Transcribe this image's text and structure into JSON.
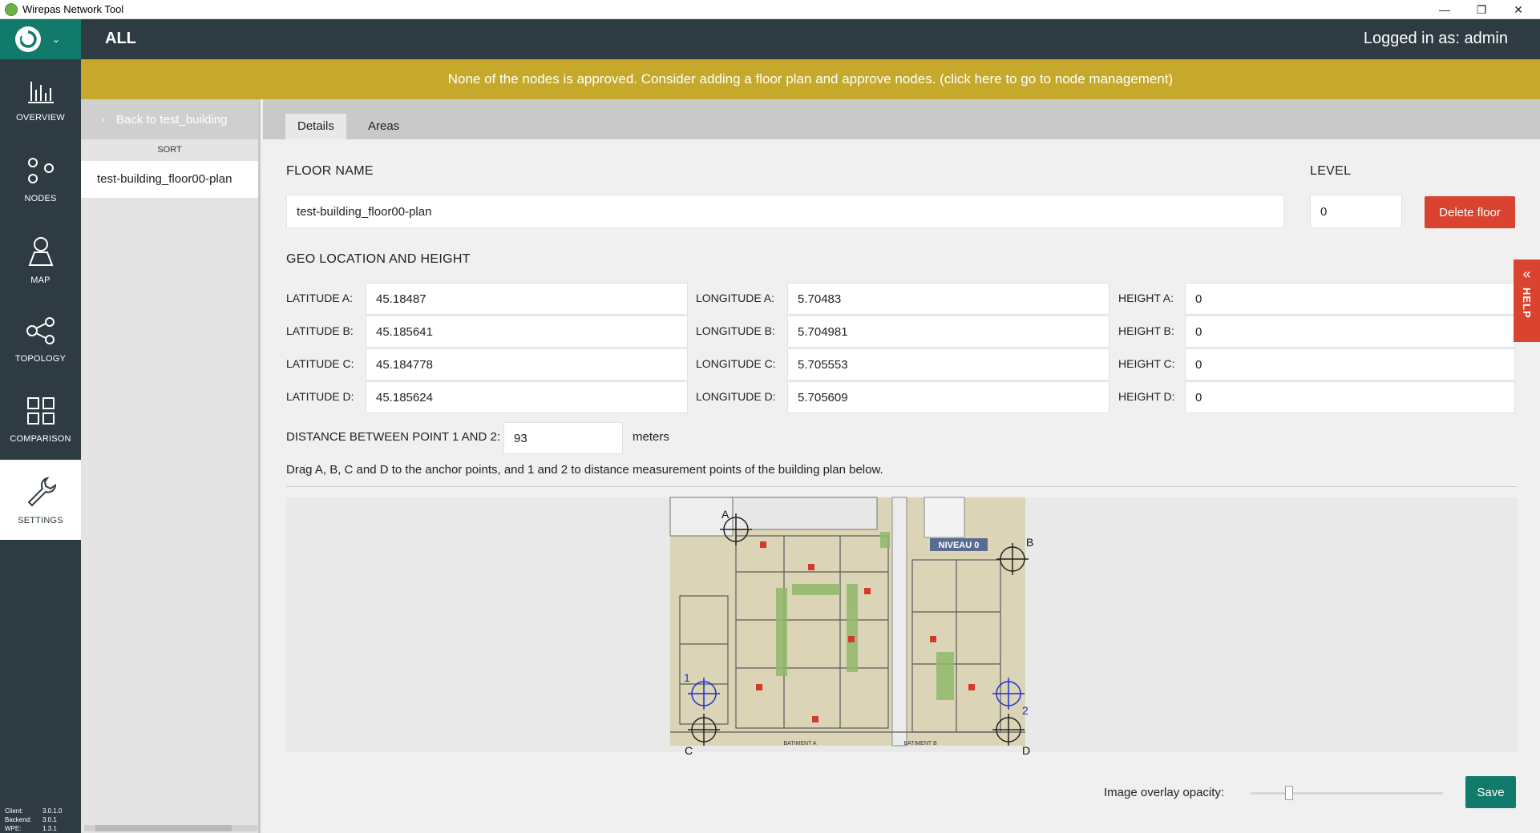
{
  "window": {
    "title": "Wirepas Network Tool",
    "minimize": "—",
    "restore": "❐",
    "close": "✕"
  },
  "nav": {
    "items": [
      {
        "label": "OVERVIEW",
        "icon": "bar-chart-icon"
      },
      {
        "label": "NODES",
        "icon": "nodes-icon"
      },
      {
        "label": "MAP",
        "icon": "map-pin-icon"
      },
      {
        "label": "TOPOLOGY",
        "icon": "share-icon"
      },
      {
        "label": "COMPARISON",
        "icon": "grid-icon"
      },
      {
        "label": "SETTINGS",
        "icon": "wrench-icon"
      }
    ],
    "active": "SETTINGS"
  },
  "versions": {
    "client_label": "Client:",
    "client": "3.0.1.0",
    "backend_label": "Backend:",
    "backend": "3.0.1",
    "wpe_label": "WPE:",
    "wpe": "1.3.1"
  },
  "header": {
    "scope": "ALL",
    "login": "Logged in as:  admin"
  },
  "banner": {
    "text": "None of the nodes is approved. Consider adding a floor plan and approve nodes. (click here to go to node management)"
  },
  "sidebar": {
    "back_label": "Back to test_building",
    "sort_label": "SORT",
    "items": [
      "test-building_floor00-plan"
    ]
  },
  "tabs": [
    {
      "label": "Details",
      "active": true
    },
    {
      "label": "Areas",
      "active": false
    }
  ],
  "details": {
    "floor_name_label": "FLOOR NAME",
    "floor_name": "test-building_floor00-plan",
    "level_label": "LEVEL",
    "level": "0",
    "delete_label": "Delete floor",
    "geo_title": "GEO LOCATION AND HEIGHT",
    "geo": [
      {
        "lat_label": "LATITUDE A:",
        "lat": "45.18487",
        "lon_label": "LONGITUDE A:",
        "lon": "5.70483",
        "h_label": "HEIGHT A:",
        "h": "0"
      },
      {
        "lat_label": "LATITUDE B:",
        "lat": "45.185641",
        "lon_label": "LONGITUDE B:",
        "lon": "5.704981",
        "h_label": "HEIGHT B:",
        "h": "0"
      },
      {
        "lat_label": "LATITUDE C:",
        "lat": "45.184778",
        "lon_label": "LONGITUDE C:",
        "lon": "5.705553",
        "h_label": "HEIGHT C:",
        "h": "0"
      },
      {
        "lat_label": "LATITUDE D:",
        "lat": "45.185624",
        "lon_label": "LONGITUDE D:",
        "lon": "5.705609",
        "h_label": "HEIGHT D:",
        "h": "0"
      }
    ],
    "distance_label": "DISTANCE BETWEEN POINT 1 AND 2:",
    "distance": "93",
    "distance_unit": "meters",
    "instruction": "Drag A, B, C and D to the anchor points, and 1 and 2 to distance measurement points of the building plan below.",
    "anchors": {
      "a": "A",
      "b": "B",
      "c": "C",
      "d": "D",
      "p1": "1",
      "p2": "2"
    },
    "plan_labels": {
      "niveau": "NIVEAU 0",
      "batiment_a": "BATIMENT A",
      "batiment_b": "BATIMENT B"
    },
    "opacity_label": "Image overlay opacity:",
    "opacity_value": 0.2,
    "save_label": "Save"
  },
  "help": {
    "label": "HELP",
    "arrow": "«"
  },
  "colors": {
    "rail": "#2f3b43",
    "accent": "#117a6a",
    "banner": "#c6a92a",
    "danger": "#d9432f"
  }
}
